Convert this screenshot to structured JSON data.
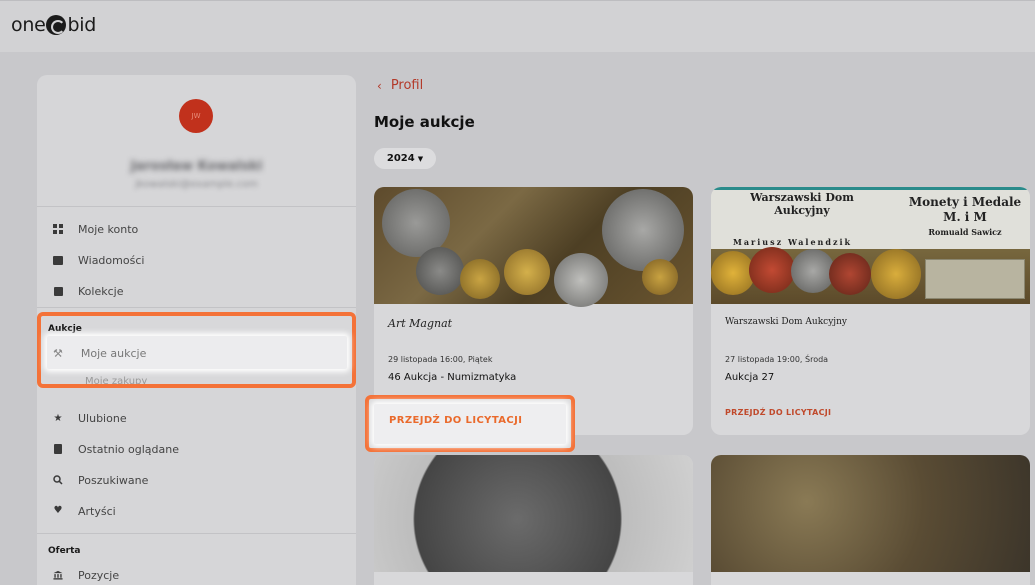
{
  "app": {
    "logo_left": "one",
    "logo_right": "bid"
  },
  "user": {
    "initials": "JW",
    "name": "Jarosław Kowalski",
    "email": "jkowalski@example.com"
  },
  "sidebar": {
    "items_top": [
      {
        "label": "Moje konto",
        "icon": "dashboard-icon"
      },
      {
        "label": "Wiadomości",
        "icon": "message-icon"
      },
      {
        "label": "Kolekcje",
        "icon": "collection-icon"
      }
    ],
    "section_aukcje": "Aukcje",
    "aukcje_items": [
      {
        "label": "Moje aukcje",
        "icon": "gavel-icon"
      },
      {
        "label": "Moje zakupy",
        "icon": "bag-icon"
      }
    ],
    "items_mid": [
      {
        "label": "Ulubione",
        "icon": "star-icon"
      },
      {
        "label": "Ostatnio oglądane",
        "icon": "history-icon"
      },
      {
        "label": "Poszukiwane",
        "icon": "search-icon"
      },
      {
        "label": "Artyści",
        "icon": "heart-icon"
      }
    ],
    "section_oferta": "Oferta",
    "oferta_items": [
      {
        "label": "Pozycje",
        "icon": "bank-icon"
      }
    ]
  },
  "main": {
    "back_label": "Profil",
    "title": "Moje aukcje",
    "year_filter": "2024"
  },
  "cards": [
    {
      "house": "Art Magnat",
      "date": "29 listopada 16:00, Piątek",
      "title": "46 Aukcja - Numizmatyka",
      "cta": "PRZEJDŹ DO LICYTACJI"
    },
    {
      "house": "Warszawski Dom Aukcyjny",
      "date": "27 listopada 19:00, Środa",
      "title": "Aukcja 27",
      "cta": "PRZEJDŹ DO LICYTACJI",
      "banner_left": "Warszawski Dom Aukcyjny",
      "banner_right_1": "Monety i Medale",
      "banner_right_2": "M. i M",
      "banner_right_3": "Romuald Sawicz",
      "banner_left_sub": "Mariusz Walendzik"
    }
  ],
  "colors": {
    "accent": "#f47238",
    "link": "#b33a2a",
    "avatar": "#c1311c"
  }
}
